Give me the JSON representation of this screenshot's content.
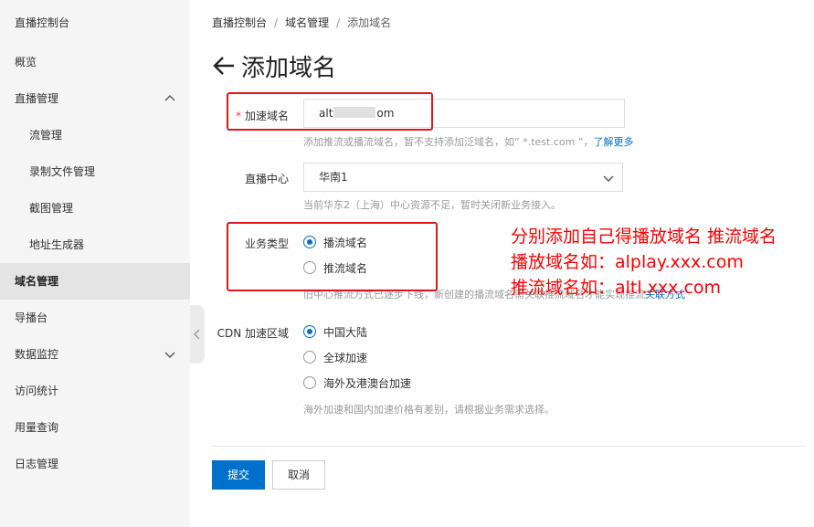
{
  "sidebar": {
    "title": "直播控制台",
    "items": [
      {
        "label": "概览"
      },
      {
        "label": "直播管理"
      },
      {
        "label": "流管理"
      },
      {
        "label": "录制文件管理"
      },
      {
        "label": "截图管理"
      },
      {
        "label": "地址生成器"
      },
      {
        "label": "域名管理"
      },
      {
        "label": "导播台"
      },
      {
        "label": "数据监控"
      },
      {
        "label": "访问统计"
      },
      {
        "label": "用量查询"
      },
      {
        "label": "日志管理"
      }
    ]
  },
  "breadcrumb": [
    "直播控制台",
    "域名管理",
    "添加域名"
  ],
  "page_title": "添加域名",
  "form": {
    "domain": {
      "required_mark": "*",
      "label": "加速域名",
      "value_prefix": "alt",
      "value_suffix": "om",
      "hint": "添加推流或播流域名，暂不支持添加泛域名，如“ *.test.com ”，",
      "hint_link": "了解更多"
    },
    "center": {
      "label": "直播中心",
      "value": "华南1",
      "hint": "当前华东2（上海）中心资源不足，暂时关闭新业务接入。"
    },
    "business_type": {
      "label": "业务类型",
      "options": [
        "播流域名",
        "推流域名"
      ],
      "hint": "旧中心推流方式已逐步下线，新创建的播流域名需关联推流域名才能实现推流",
      "hint_link": "关联方式"
    },
    "cdn_region": {
      "label": "CDN 加速区域",
      "options": [
        "中国大陆",
        "全球加速",
        "海外及港澳台加速"
      ],
      "hint": "海外加速和国内加速价格有差别，请根据业务需求选择。"
    }
  },
  "annotation": {
    "line1": "分别添加自己得播放域名 推流域名",
    "line2": "播放域名如：alplay.xxx.com",
    "line3": "推流域名如：altl.xxx.com"
  },
  "buttons": {
    "submit": "提交",
    "cancel": "取消"
  },
  "colors": {
    "primary": "#0070cc",
    "annotation_red": "#ff0000",
    "highlight_box": "#e0161a",
    "sidebar_bg": "#f5f5f5",
    "sidebar_active_bg": "#e4e4e4"
  }
}
